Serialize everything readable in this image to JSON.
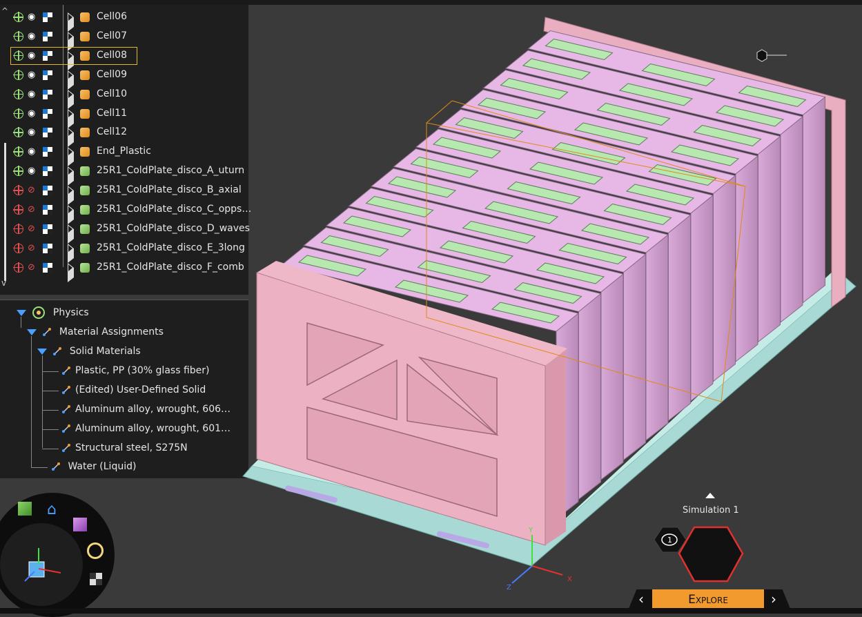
{
  "tree": {
    "rows": [
      {
        "label": "Cell06",
        "visible": true,
        "kind": "orange"
      },
      {
        "label": "Cell07",
        "visible": true,
        "kind": "orange"
      },
      {
        "label": "Cell08",
        "visible": true,
        "kind": "orange"
      },
      {
        "label": "Cell09",
        "visible": true,
        "kind": "orange"
      },
      {
        "label": "Cell10",
        "visible": true,
        "kind": "orange"
      },
      {
        "label": "Cell11",
        "visible": true,
        "kind": "orange"
      },
      {
        "label": "Cell12",
        "visible": true,
        "kind": "orange"
      },
      {
        "label": "End_Plastic",
        "visible": true,
        "kind": "orange"
      },
      {
        "label": "25R1_ColdPlate_disco_A_uturn",
        "visible": true,
        "kind": "green"
      },
      {
        "label": "25R1_ColdPlate_disco_B_axial",
        "visible": false,
        "kind": "green"
      },
      {
        "label": "25R1_ColdPlate_disco_C_opps…",
        "visible": false,
        "kind": "green"
      },
      {
        "label": "25R1_ColdPlate_disco_D_waves",
        "visible": false,
        "kind": "green"
      },
      {
        "label": "25R1_ColdPlate_disco_E_3long",
        "visible": false,
        "kind": "green"
      },
      {
        "label": "25R1_ColdPlate_disco_F_comb",
        "visible": false,
        "kind": "green"
      }
    ],
    "selected_index": 2
  },
  "physics": {
    "root": "Physics",
    "material_assignments": "Material Assignments",
    "solid_materials": "Solid Materials",
    "materials": [
      "Plastic, PP (30% glass fiber)",
      "(Edited) User-Defined Solid",
      "Aluminum alloy, wrought, 606…",
      "Aluminum alloy, wrought, 601…",
      "Structural steel, S275N"
    ],
    "fluid": "Water (Liquid)"
  },
  "simulation": {
    "label": "Simulation 1",
    "comment_count": "1",
    "mode": "Explore"
  },
  "colors": {
    "accent": "#f29a2e",
    "selection": "#e5b826",
    "cell_pink": "#e7b8e6",
    "plate_pink": "#e9aebf",
    "cooling": "#b7e8b0",
    "base": "#a8d9d4"
  }
}
